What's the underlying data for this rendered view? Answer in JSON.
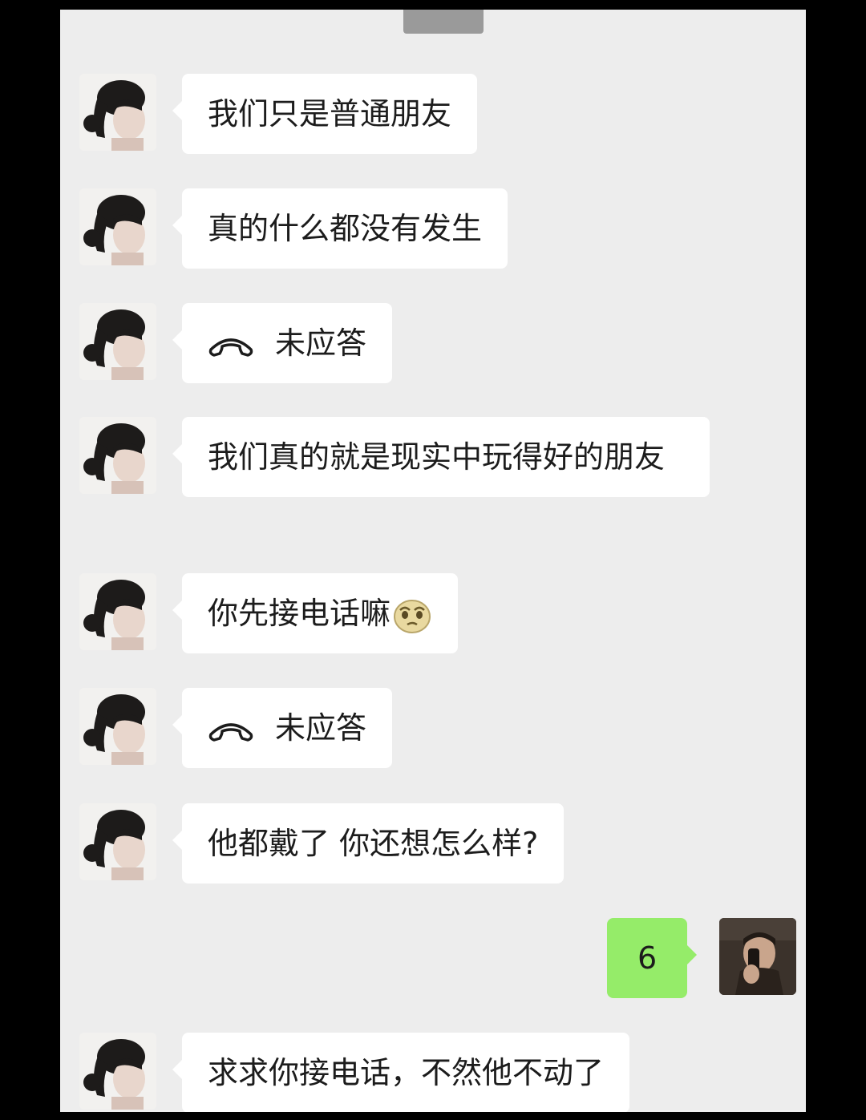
{
  "messages": [
    {
      "from": "other",
      "text": "我们只是普通朋友"
    },
    {
      "from": "other",
      "text": "真的什么都没有发生"
    },
    {
      "from": "other",
      "type": "call",
      "icon": "phone-hangup-icon",
      "text": "未应答"
    },
    {
      "from": "other",
      "text": "我们真的就是现实中玩得好的朋友"
    },
    {
      "from": "other",
      "text": "你先接电话嘛",
      "emoji": "pleading-face-icon"
    },
    {
      "from": "other",
      "type": "call",
      "icon": "phone-hangup-icon",
      "text": "未应答"
    },
    {
      "from": "other",
      "text": "他都戴了 你还想怎么样?"
    },
    {
      "from": "self",
      "text": "6"
    },
    {
      "from": "other",
      "text": "求求你接电话，不然他不动了"
    }
  ],
  "colors": {
    "background": "#ededed",
    "bubble_other": "#ffffff",
    "bubble_self": "#95ec69",
    "text": "#1c1c1c"
  }
}
